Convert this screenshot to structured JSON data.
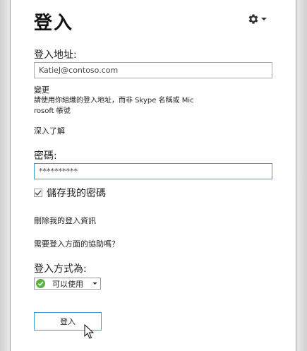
{
  "title": "登入",
  "settings": {
    "icon": "gear-icon"
  },
  "signin_address": {
    "label": "登入地址:",
    "value": "KatieJ@contoso.com",
    "change_link": "變更",
    "hint_line1": "請使用你組織的登入地址，而非 Skype 名稱或 Mic",
    "hint_line2": "rosoft 帳號",
    "learn_more": "深入了解"
  },
  "password": {
    "label": "密碼:",
    "value": "**********",
    "save_label": "儲存我的密碼",
    "save_checked": true
  },
  "delete_info_link": "刪除我的登入資訊",
  "help_link": "需要登入方面的協助嗎？",
  "signin_as": {
    "label": "登入方式為:",
    "status": "可以使用",
    "status_color": "#5db33f"
  },
  "signin_button": "登入"
}
